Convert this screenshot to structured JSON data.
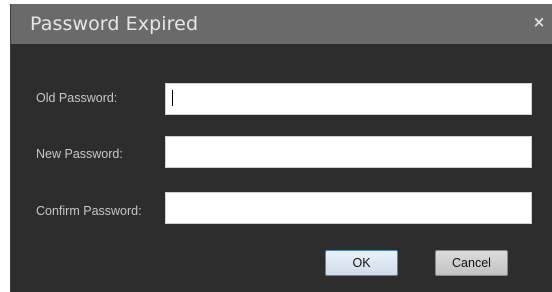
{
  "dialog": {
    "title": "Password Expired",
    "close_glyph": "×",
    "close_icon": "close-icon"
  },
  "form": {
    "old_password": {
      "label": "Old Password:",
      "value": ""
    },
    "new_password": {
      "label": "New Password:",
      "value": ""
    },
    "confirm_password": {
      "label": "Confirm Password:",
      "value": ""
    }
  },
  "buttons": {
    "ok_label": "OK",
    "cancel_label": "Cancel"
  },
  "colors": {
    "dialog_background": "#2d2d2d",
    "titlebar_background": "#6a6a6a",
    "ok_border_accent": "#4f88c0"
  }
}
